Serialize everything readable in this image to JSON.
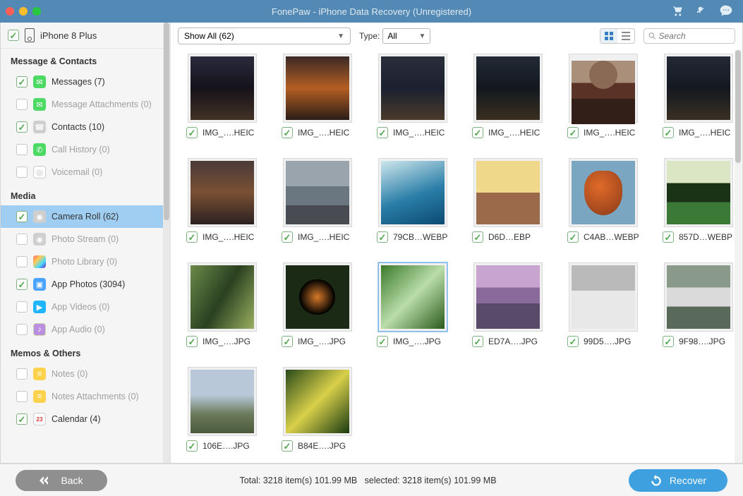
{
  "title": "FonePaw - iPhone Data Recovery (Unregistered)",
  "device_name": "iPhone 8 Plus",
  "sections": {
    "msg": {
      "label": "Message & Contacts",
      "items": [
        {
          "label": "Messages (7)",
          "checked": true,
          "enabled": true
        },
        {
          "label": "Message Attachments (0)",
          "checked": false,
          "enabled": false
        },
        {
          "label": "Contacts (10)",
          "checked": true,
          "enabled": true
        },
        {
          "label": "Call History (0)",
          "checked": false,
          "enabled": false
        },
        {
          "label": "Voicemail (0)",
          "checked": false,
          "enabled": false
        }
      ]
    },
    "media": {
      "label": "Media",
      "items": [
        {
          "label": "Camera Roll (62)",
          "checked": true,
          "enabled": true,
          "selected": true
        },
        {
          "label": "Photo Stream (0)",
          "checked": false,
          "enabled": false
        },
        {
          "label": "Photo Library (0)",
          "checked": false,
          "enabled": false
        },
        {
          "label": "App Photos (3094)",
          "checked": true,
          "enabled": true
        },
        {
          "label": "App Videos (0)",
          "checked": false,
          "enabled": false
        },
        {
          "label": "App Audio (0)",
          "checked": false,
          "enabled": false
        }
      ]
    },
    "memos": {
      "label": "Memos & Others",
      "items": [
        {
          "label": "Notes (0)",
          "checked": false,
          "enabled": false
        },
        {
          "label": "Notes Attachments (0)",
          "checked": false,
          "enabled": false
        },
        {
          "label": "Calendar (4)",
          "checked": true,
          "enabled": true
        }
      ]
    }
  },
  "toolbar": {
    "filter_value": "Show All (62)",
    "type_label": "Type:",
    "type_value": "All",
    "search_placeholder": "Search"
  },
  "thumbs": [
    {
      "caption": "IMG_….HEIC"
    },
    {
      "caption": "IMG_….HEIC"
    },
    {
      "caption": "IMG_….HEIC"
    },
    {
      "caption": "IMG_….HEIC"
    },
    {
      "caption": "IMG_….HEIC"
    },
    {
      "caption": "IMG_….HEIC"
    },
    {
      "caption": "IMG_….HEIC"
    },
    {
      "caption": "IMG_….HEIC"
    },
    {
      "caption": "79CB…WEBP"
    },
    {
      "caption": "D6D…EBP"
    },
    {
      "caption": "C4AB…WEBP"
    },
    {
      "caption": "857D…WEBP"
    },
    {
      "caption": "IMG_….JPG"
    },
    {
      "caption": "IMG_….JPG"
    },
    {
      "caption": "IMG_….JPG",
      "highlight": true
    },
    {
      "caption": "ED7A….JPG"
    },
    {
      "caption": "99D5….JPG"
    },
    {
      "caption": "9F98….JPG"
    },
    {
      "caption": "106E….JPG"
    },
    {
      "caption": "B84E….JPG"
    }
  ],
  "footer": {
    "total": "Total: 3218 item(s) 101.99 MB",
    "selected": "selected: 3218 item(s) 101.99 MB",
    "back": "Back",
    "recover": "Recover"
  }
}
